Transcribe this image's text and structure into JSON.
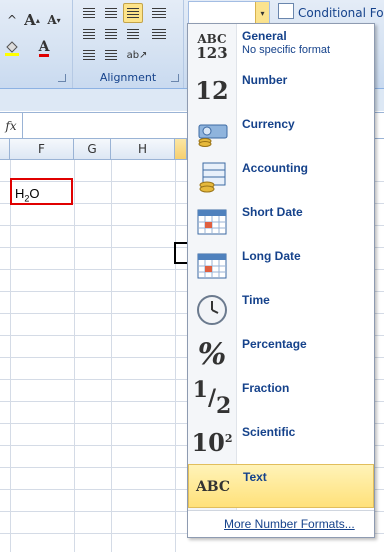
{
  "ribbon": {
    "alignment_label": "Alignment",
    "number_format_value": "",
    "conditional_formatting_label": "Conditional For"
  },
  "formula_bar": {
    "fx_label": "fx",
    "value": ""
  },
  "columns": [
    "F",
    "G",
    "H"
  ],
  "cell_f_text": {
    "main": "H",
    "sub": "2",
    "tail": "O"
  },
  "number_format_menu": {
    "items": [
      {
        "label": "General",
        "sublabel": "No specific format",
        "icon": "abc-123-icon"
      },
      {
        "label": "Number",
        "icon": "number-12-icon"
      },
      {
        "label": "Currency",
        "icon": "currency-icon"
      },
      {
        "label": "Accounting",
        "icon": "accounting-icon"
      },
      {
        "label": "Short Date",
        "icon": "calendar-icon"
      },
      {
        "label": "Long Date",
        "icon": "calendar-icon"
      },
      {
        "label": "Time",
        "icon": "clock-icon"
      },
      {
        "label": "Percentage",
        "icon": "percent-icon"
      },
      {
        "label": "Fraction",
        "icon": "fraction-icon"
      },
      {
        "label": "Scientific",
        "icon": "scientific-icon"
      },
      {
        "label": "Text",
        "icon": "abc-text-icon",
        "highlighted": true
      }
    ],
    "more_label": "More Number Formats..."
  },
  "icon_glyphs": {
    "general_top": "ABC",
    "general_bottom": "123",
    "number": "12",
    "fraction_num": "1",
    "fraction_den": "2",
    "sci_base": "10",
    "sci_exp": "2",
    "percent": "%",
    "text": "ABC",
    "font_grow": "A",
    "font_color": "A",
    "dropdown_arrow": "▾"
  },
  "colors": {
    "accent_text": "#15428b",
    "highlight": "#ffe17a",
    "cell_border": "#e00000"
  }
}
